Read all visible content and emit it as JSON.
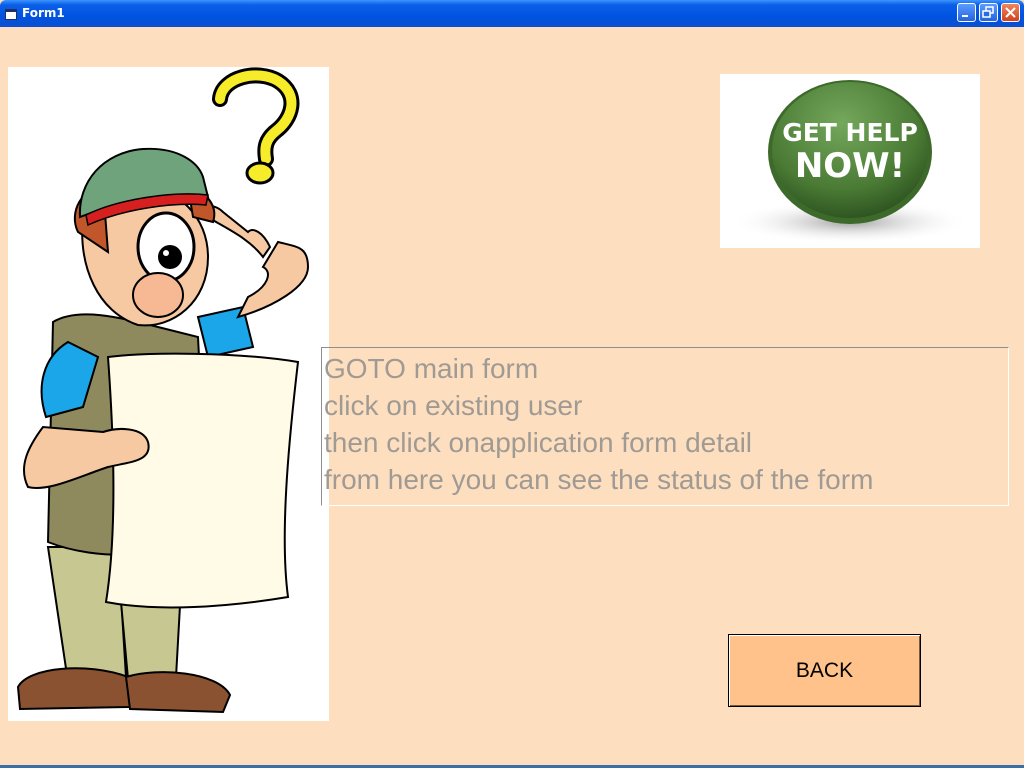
{
  "window": {
    "title": "Form1"
  },
  "icons": {
    "app": "form-window-icon",
    "minimize": "minimize-icon",
    "maximize": "restore-icon",
    "close": "close-icon"
  },
  "help_image": {
    "line1": "GET HELP",
    "line2": "NOW!"
  },
  "instructions": {
    "lines": [
      "GOTO main form",
      "click on existing user",
      "then click onapplication form detail",
      "from here you can see the status of the form"
    ]
  },
  "buttons": {
    "back_label": "BACK"
  },
  "colors": {
    "background": "#fddfbf",
    "back_button": "#ffc28a",
    "instructions_text": "#a09a94",
    "titlebar": "#0053e1"
  }
}
